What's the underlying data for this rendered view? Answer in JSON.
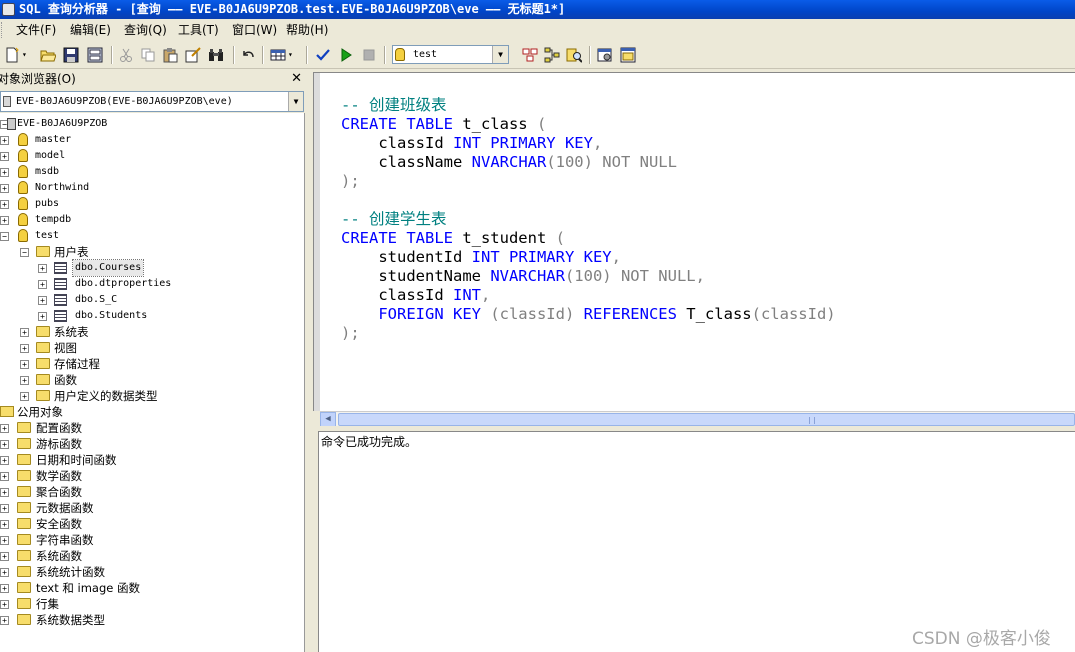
{
  "window": {
    "title": "SQL 查询分析器 - [查询 —— EVE-B0JA6U9PZOB.test.EVE-B0JA6U9PZOB\\eve —— 无标题1*]"
  },
  "menu": [
    {
      "label": "文件(F)"
    },
    {
      "label": "编辑(E)"
    },
    {
      "label": "查询(Q)"
    },
    {
      "label": "工具(T)"
    },
    {
      "label": "窗口(W)"
    },
    {
      "label": "帮助(H)"
    }
  ],
  "toolbar": {
    "database": "test"
  },
  "object_browser": {
    "title": "对象浏览器(O)",
    "close": "✕",
    "server_select": "EVE-B0JA6U9PZOB(EVE-B0JA6U9PZOB\\eve)",
    "server": "EVE-B0JA6U9PZOB",
    "databases": [
      "master",
      "model",
      "msdb",
      "Northwind",
      "pubs",
      "tempdb",
      "test"
    ],
    "test_children": {
      "user_tables": "用户表",
      "tables": [
        "dbo.Courses",
        "dbo.dtproperties",
        "dbo.S_C",
        "dbo.Students"
      ],
      "system_tables": "系统表",
      "views": "视图",
      "procedures": "存储过程",
      "functions": "函数",
      "udt": "用户定义的数据类型"
    },
    "common": "公用对象",
    "common_items": [
      "配置函数",
      "游标函数",
      "日期和时间函数",
      "数学函数",
      "聚合函数",
      "元数据函数",
      "安全函数",
      "字符串函数",
      "系统函数",
      "系统统计函数",
      "text 和 image 函数",
      "行集",
      "系统数据类型"
    ]
  },
  "editor": {
    "lines": [
      [
        {
          "t": "-- 创建班级表",
          "c": "cm"
        }
      ],
      [
        {
          "t": "CREATE TABLE",
          "c": "kw"
        },
        {
          "t": " t_class ",
          "c": "id"
        },
        {
          "t": "(",
          "c": "gr"
        }
      ],
      [
        {
          "t": "    classId ",
          "c": "id"
        },
        {
          "t": "INT PRIMARY KEY",
          "c": "kw"
        },
        {
          "t": ",",
          "c": "gr"
        }
      ],
      [
        {
          "t": "    className ",
          "c": "id"
        },
        {
          "t": "NVARCHAR",
          "c": "kw"
        },
        {
          "t": "(100) NOT NULL",
          "c": "gr"
        }
      ],
      [
        {
          "t": ");",
          "c": "gr"
        }
      ],
      [
        {
          "t": "",
          "c": "id"
        }
      ],
      [
        {
          "t": "-- 创建学生表",
          "c": "cm"
        }
      ],
      [
        {
          "t": "CREATE TABLE",
          "c": "kw"
        },
        {
          "t": " t_student ",
          "c": "id"
        },
        {
          "t": "(",
          "c": "gr"
        }
      ],
      [
        {
          "t": "    studentId ",
          "c": "id"
        },
        {
          "t": "INT PRIMARY KEY",
          "c": "kw"
        },
        {
          "t": ",",
          "c": "gr"
        }
      ],
      [
        {
          "t": "    studentName ",
          "c": "id"
        },
        {
          "t": "NVARCHAR",
          "c": "kw"
        },
        {
          "t": "(100) NOT NULL,",
          "c": "gr"
        }
      ],
      [
        {
          "t": "    classId ",
          "c": "id"
        },
        {
          "t": "INT",
          "c": "kw"
        },
        {
          "t": ",",
          "c": "gr"
        }
      ],
      [
        {
          "t": "    ",
          "c": "id"
        },
        {
          "t": "FOREIGN KEY",
          "c": "kw"
        },
        {
          "t": " (classId) ",
          "c": "gr"
        },
        {
          "t": "REFERENCES",
          "c": "kw"
        },
        {
          "t": " T_class",
          "c": "id"
        },
        {
          "t": "(classId)",
          "c": "gr"
        }
      ],
      [
        {
          "t": ");",
          "c": "gr"
        }
      ]
    ]
  },
  "results": {
    "message": "命令已成功完成。"
  },
  "watermark": "CSDN @极客小俊"
}
